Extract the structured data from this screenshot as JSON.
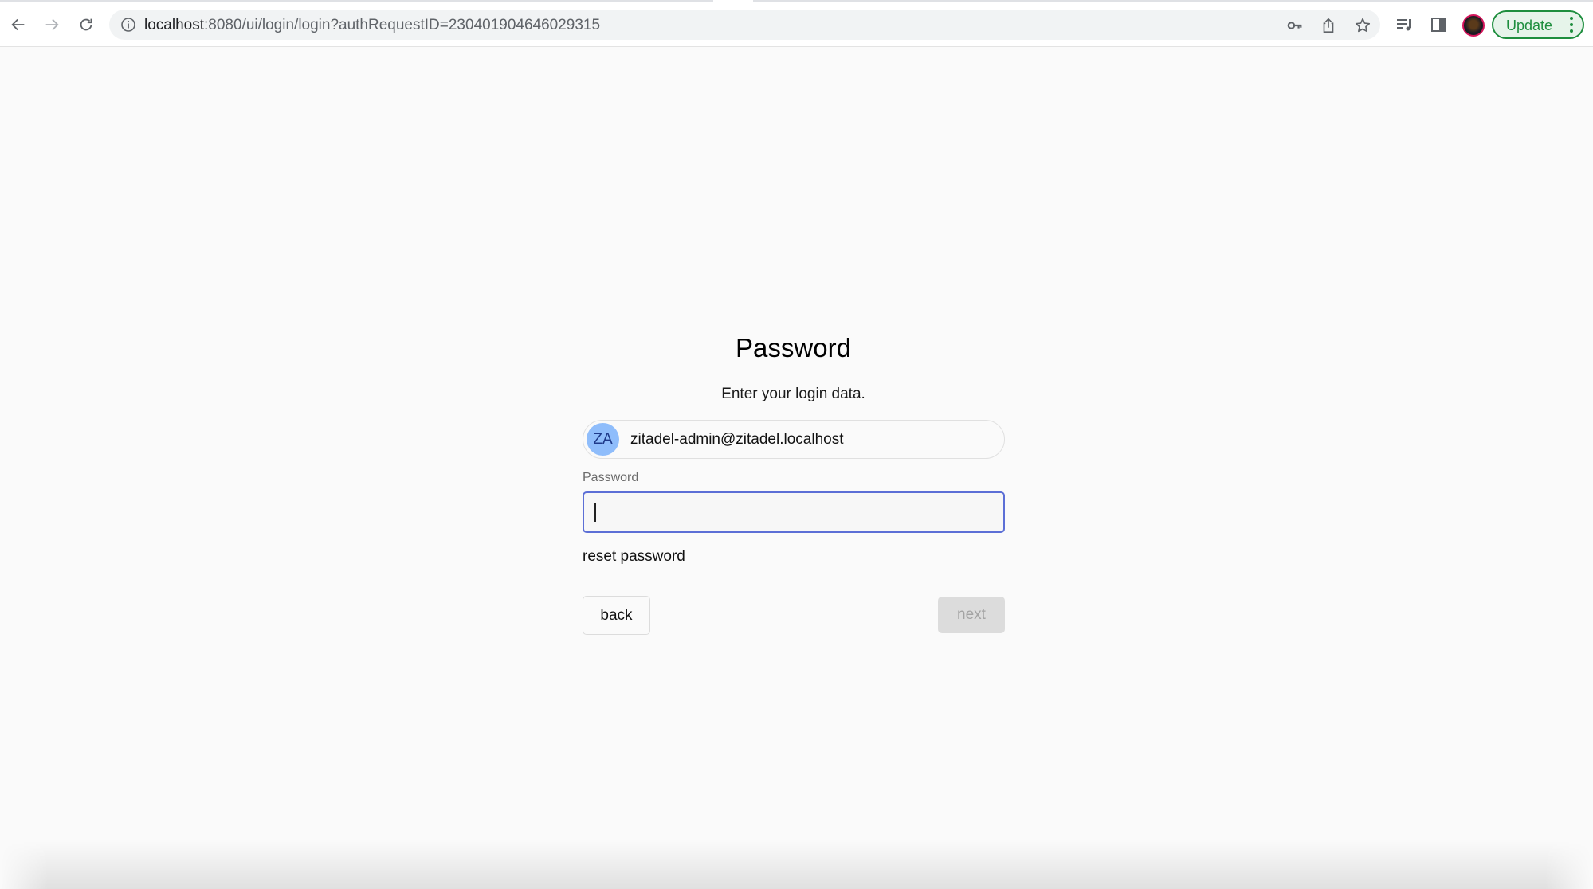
{
  "browser": {
    "url_host": "localhost",
    "url_rest": ":8080/ui/login/login?authRequestID=230401904646029315",
    "icons": [
      "back-arrow-icon",
      "forward-arrow-icon",
      "reload-icon",
      "info-icon",
      "key-icon",
      "share-icon",
      "star-icon",
      "media-queue-icon",
      "side-panel-icon",
      "profile-avatar"
    ],
    "update_label": "Update"
  },
  "login": {
    "title": "Password",
    "subtitle": "Enter your login data.",
    "user": {
      "initials": "ZA",
      "email": "zitadel-admin@zitadel.localhost",
      "avatar_color": "#8fbdfb"
    },
    "password_label": "Password",
    "password_value": "",
    "reset_link": "reset password",
    "back_label": "back",
    "next_label": "next",
    "accent_color": "#5c6fd6"
  }
}
